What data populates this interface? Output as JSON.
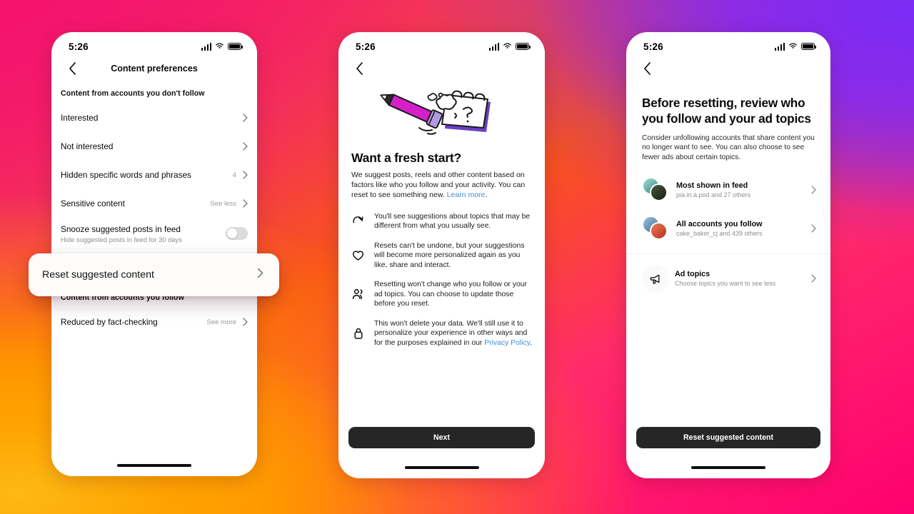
{
  "background": {
    "gradient_colors": [
      "#F4146E",
      "#F8531A",
      "#FDB913",
      "#7B2BF5",
      "#FF0070"
    ]
  },
  "phone1": {
    "status": {
      "time": "5:26",
      "signal_icon": "cellular-signal-icon",
      "wifi_icon": "wifi-icon",
      "battery_icon": "battery-full-icon"
    },
    "nav": {
      "back_icon": "chevron-left-icon",
      "title": "Content preferences"
    },
    "section1_header": "Content from accounts you don't follow",
    "rows": [
      {
        "label": "Interested",
        "value": "",
        "chevron": "chevron-right-icon"
      },
      {
        "label": "Not interested",
        "value": "",
        "chevron": "chevron-right-icon"
      },
      {
        "label": "Hidden specific words and phrases",
        "value": "4",
        "chevron": "chevron-right-icon"
      },
      {
        "label": "Sensitive content",
        "value": "See less",
        "chevron": "chevron-right-icon"
      }
    ],
    "snooze": {
      "label": "Snooze suggested posts in feed",
      "sub": "Hide suggested posts in feed for 30 days",
      "toggle_state": "off"
    },
    "highlight": {
      "label": "Reset suggested content",
      "chevron": "chevron-right-icon"
    },
    "section2_header": "Content from accounts you follow",
    "rows2": [
      {
        "label": "Reduced by fact-checking",
        "value": "See more",
        "chevron": "chevron-right-icon"
      }
    ]
  },
  "phone2": {
    "status": {
      "time": "5:26",
      "signal_icon": "cellular-signal-icon",
      "wifi_icon": "wifi-icon",
      "battery_icon": "battery-full-icon"
    },
    "nav": {
      "back_icon": "chevron-left-icon"
    },
    "illustration": "pencil-erasing-notepad-illustration",
    "title": "Want a fresh start?",
    "body_part1": "We suggest posts, reels and other content based on factors like who you follow and your activity. You can reset to see something new. ",
    "body_link": "Learn more",
    "body_part2": ".",
    "bullets": [
      {
        "icon": "refresh-icon",
        "text": "You'll see suggestions about topics that may be different from what you usually see."
      },
      {
        "icon": "heart-icon",
        "text": "Resets can't be undone, but your suggestions will become more personalized again as you like, share and interact."
      },
      {
        "icon": "people-icon",
        "text": "Resetting won't change who you follow or your ad topics. You can choose to update those before you reset."
      },
      {
        "icon": "lock-icon",
        "text_part1": "This won't delete your data. We'll still use it to personalize your experience in other ways and for the purposes explained in our ",
        "link": "Privacy Policy",
        "text_part2": "."
      }
    ],
    "cta": "Next"
  },
  "phone3": {
    "status": {
      "time": "5:26",
      "signal_icon": "cellular-signal-icon",
      "wifi_icon": "wifi-icon",
      "battery_icon": "battery-full-icon"
    },
    "nav": {
      "back_icon": "chevron-left-icon"
    },
    "title": "Before resetting, review who you follow and your ad topics",
    "body": "Consider unfollowing accounts that share content you no longer want to see. You can also choose to see fewer ads about certain topics.",
    "accounts": [
      {
        "title": "Most shown in feed",
        "sub": "pia.in.a.pod and 27 others",
        "avatar_back": "#7fd4cf",
        "avatar_front": "#2e3d2a",
        "chevron": "chevron-right-icon"
      },
      {
        "title": "All accounts you follow",
        "sub": "cake_baker_cj and 439 others",
        "avatar_back": "#6f9fc4",
        "avatar_front": "#d8513a",
        "chevron": "chevron-right-icon"
      }
    ],
    "ad_topics": {
      "icon": "megaphone-icon",
      "title": "Ad topics",
      "sub": "Choose topics you want to see less",
      "chevron": "chevron-right-icon"
    },
    "cta": "Reset suggested content"
  }
}
